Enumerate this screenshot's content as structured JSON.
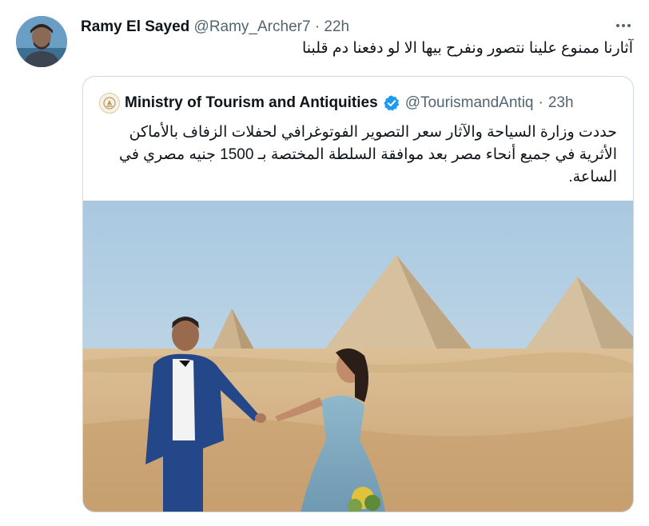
{
  "tweet": {
    "display_name": "Ramy El Sayed",
    "handle": "@Ramy_Archer7",
    "separator": "·",
    "time": "22h",
    "text": "آثارنا ممنوع علينا نتصور ونفرح بيها الا لو دفعنا دم قلبنا",
    "avatar_icon": "user-avatar",
    "more_icon": "more-icon"
  },
  "quoted_tweet": {
    "display_name": "Ministry of Tourism and Antiquities",
    "handle": "@TourismandAntiq",
    "separator": "·",
    "time": "23h",
    "verified_icon": "verified-badge-icon",
    "verified_color": "#1d9bf0",
    "text": "حددت وزارة السياحة والآثار سعر التصوير  الفوتوغرافي لحفلات الزفاف بالأماكن الأثرية في جميع أنحاء مصر بعد موافقة السلطة المختصة بـ 1500 جنيه مصري في الساعة.",
    "image_description_icon": "wedding-photo-pyramids"
  },
  "colors": {
    "text": "#0f1419",
    "secondary": "#536471",
    "border": "#cfd9de",
    "sky": "#b9d3e6",
    "sand": "#d9b88c"
  }
}
